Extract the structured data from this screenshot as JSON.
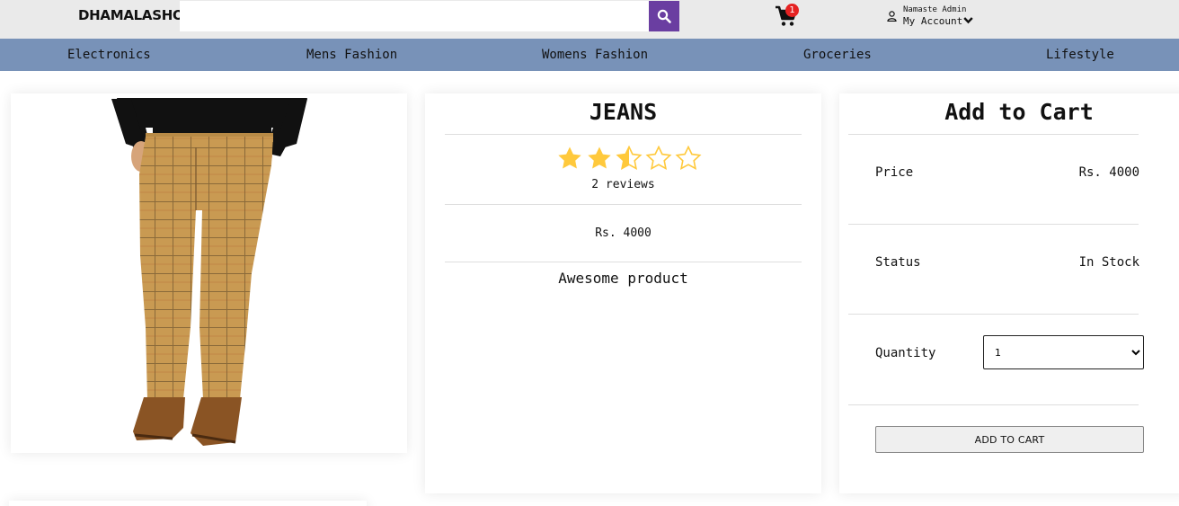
{
  "header": {
    "brand": "DHAMALASHOP",
    "search_placeholder": "",
    "search_icon": "search-icon",
    "cart_icon": "shopping-cart-icon",
    "cart_count": "1",
    "greeting": "Namaste Admin",
    "account_label": "My Account",
    "accent_color": "#6a3ea1",
    "badge_color": "#e52222"
  },
  "nav": {
    "bg_color": "#7892b8",
    "items": [
      "Electronics",
      "Mens Fashion",
      "Womens Fashion",
      "Groceries",
      "Lifestyle"
    ]
  },
  "product": {
    "title": "JEANS",
    "rating": 2.5,
    "rating_max": 5,
    "star_color": "#ffc93c",
    "reviews": "2 reviews",
    "price": "Rs. 4000",
    "description": "Awesome product",
    "image_icon": "product-image-plaid-pants"
  },
  "cart_panel": {
    "title": "Add to Cart",
    "price_label": "Price",
    "price_value": "Rs. 4000",
    "status_label": "Status",
    "status_value": "In Stock",
    "quantity_label": "Quantity",
    "quantity_selected": "1",
    "button_label": "ADD TO CART"
  }
}
